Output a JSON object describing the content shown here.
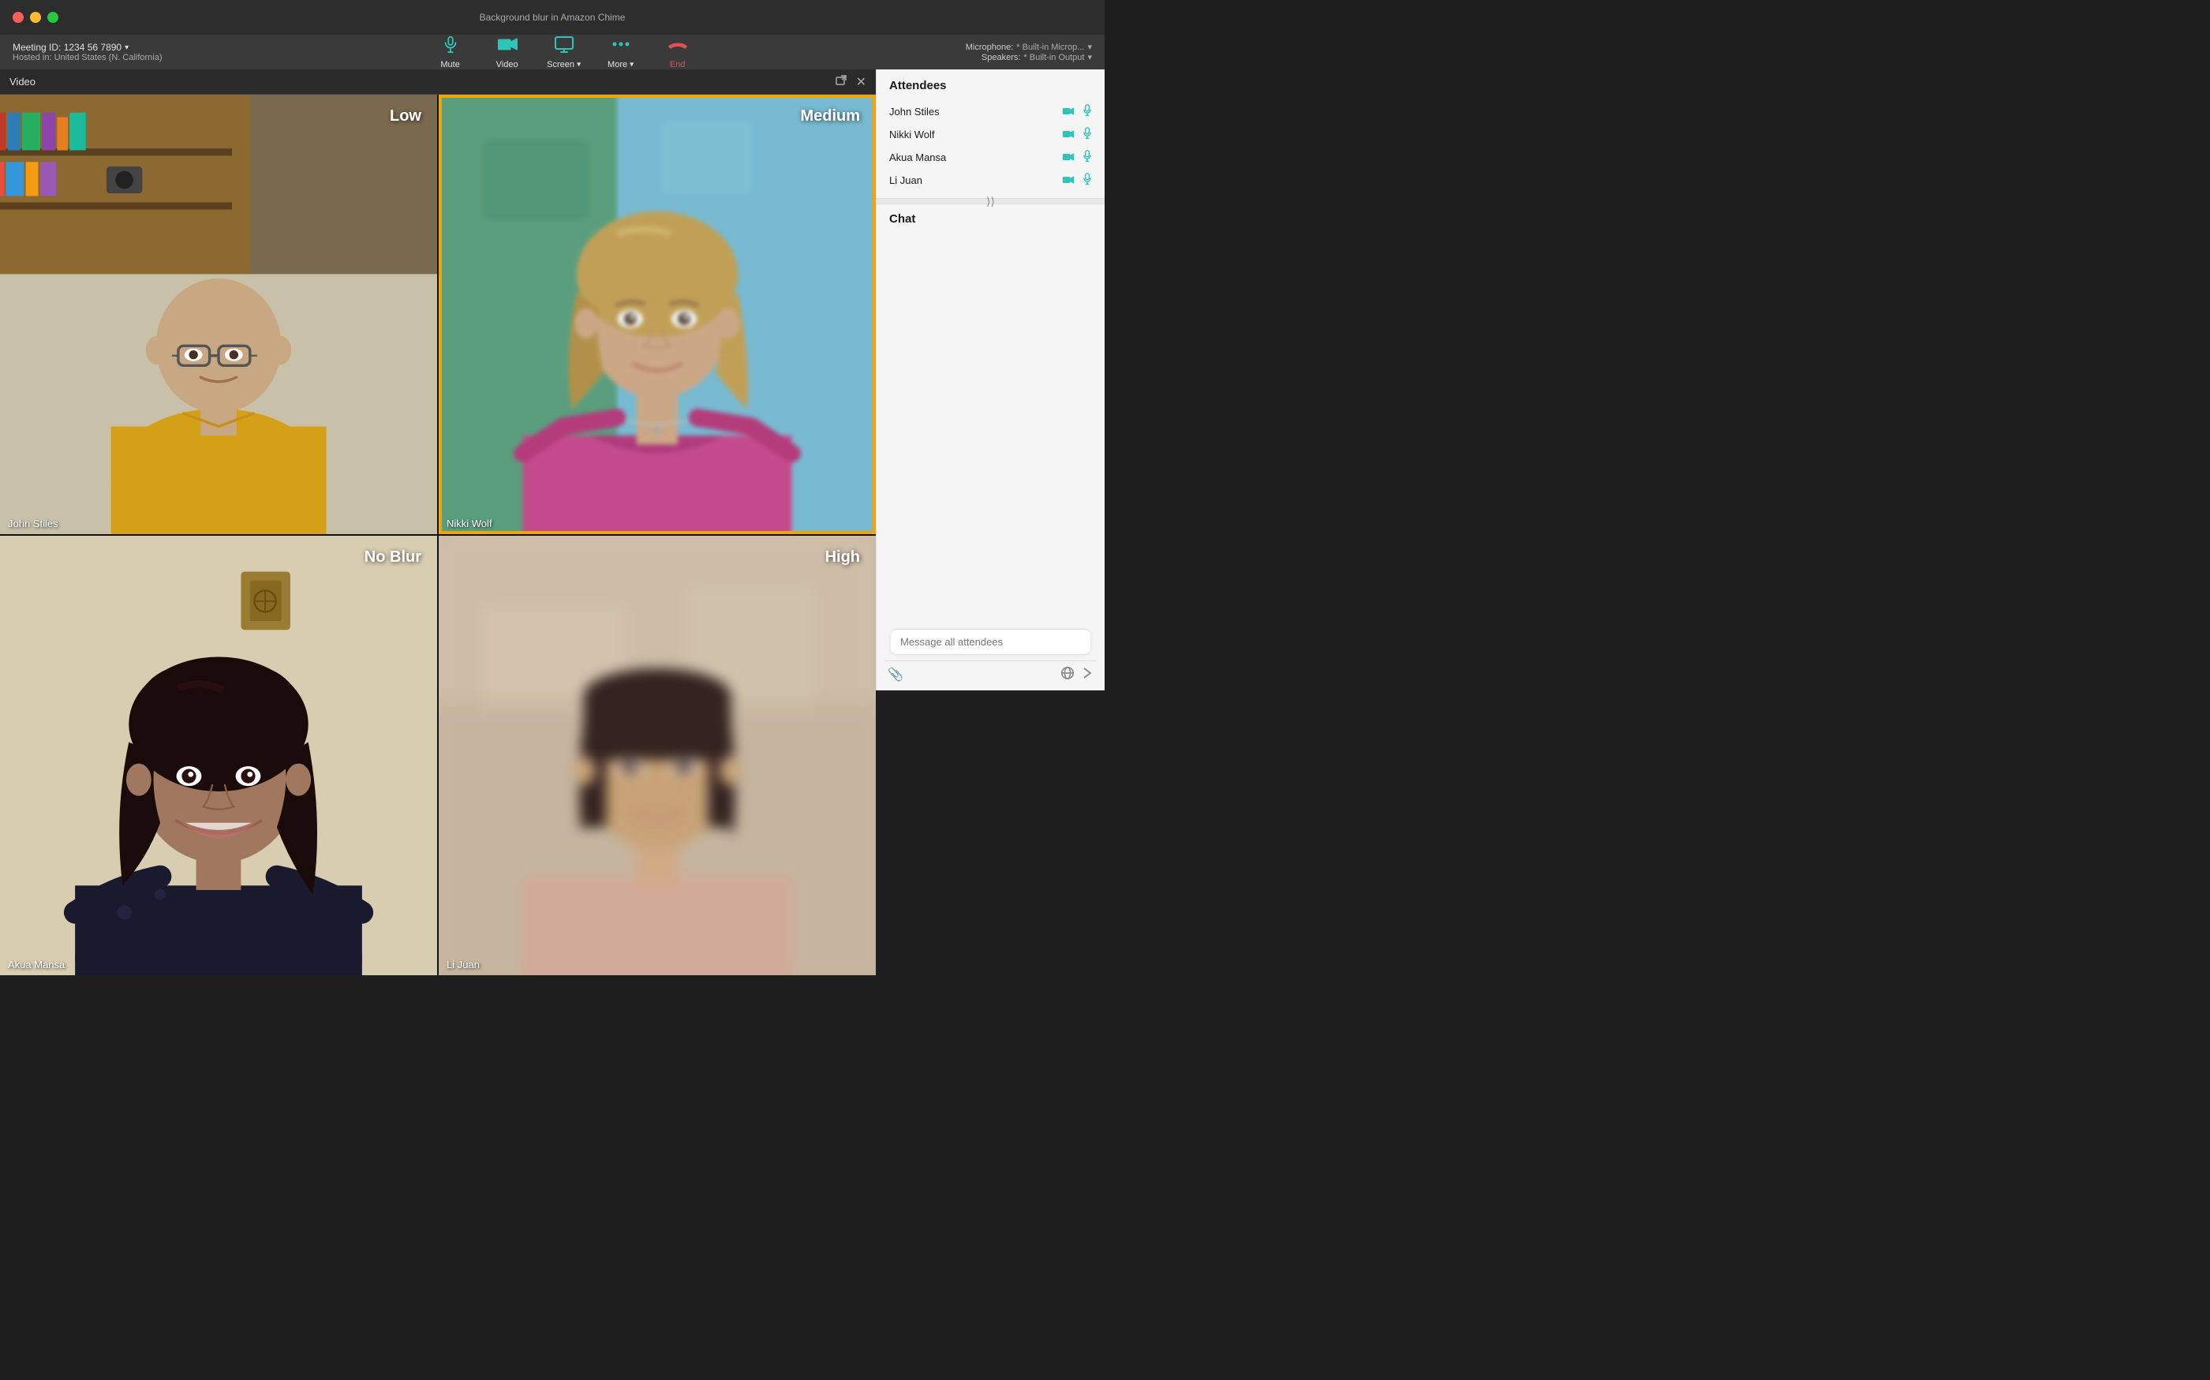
{
  "window": {
    "title": "Background blur in Amazon Chime"
  },
  "meeting": {
    "id_label": "Meeting ID: 1234 56 7890",
    "hosted_label": "Hosted in: United States (N. California)"
  },
  "toolbar": {
    "mute_label": "Mute",
    "video_label": "Video",
    "screen_label": "Screen",
    "more_label": "More",
    "end_label": "End"
  },
  "devices": {
    "microphone_label": "Microphone:",
    "microphone_value": "* Built-in Microp...",
    "speaker_label": "Speakers:",
    "speaker_value": "* Built-in Output"
  },
  "video_panel": {
    "title": "Video",
    "participants": [
      {
        "name": "John Stiles",
        "blur_label": "Low",
        "position": "top-left",
        "active": false
      },
      {
        "name": "Nikki Wolf",
        "blur_label": "Medium",
        "position": "top-right",
        "active": true
      },
      {
        "name": "Akua Mansa",
        "blur_label": "No Blur",
        "position": "bottom-left",
        "active": false
      },
      {
        "name": "Li Juan",
        "blur_label": "High",
        "position": "bottom-right",
        "active": false
      }
    ]
  },
  "sidebar": {
    "attendees_title": "Attendees",
    "attendees": [
      {
        "name": "John Stiles"
      },
      {
        "name": "Nikki Wolf"
      },
      {
        "name": "Akua Mansa"
      },
      {
        "name": "Li Juan"
      }
    ],
    "chat_title": "Chat",
    "chat_placeholder": "Message all attendees"
  },
  "colors": {
    "teal": "#2ec4b6",
    "red": "#e05252",
    "gold": "#f0a500",
    "border_active": "#f0a500"
  }
}
